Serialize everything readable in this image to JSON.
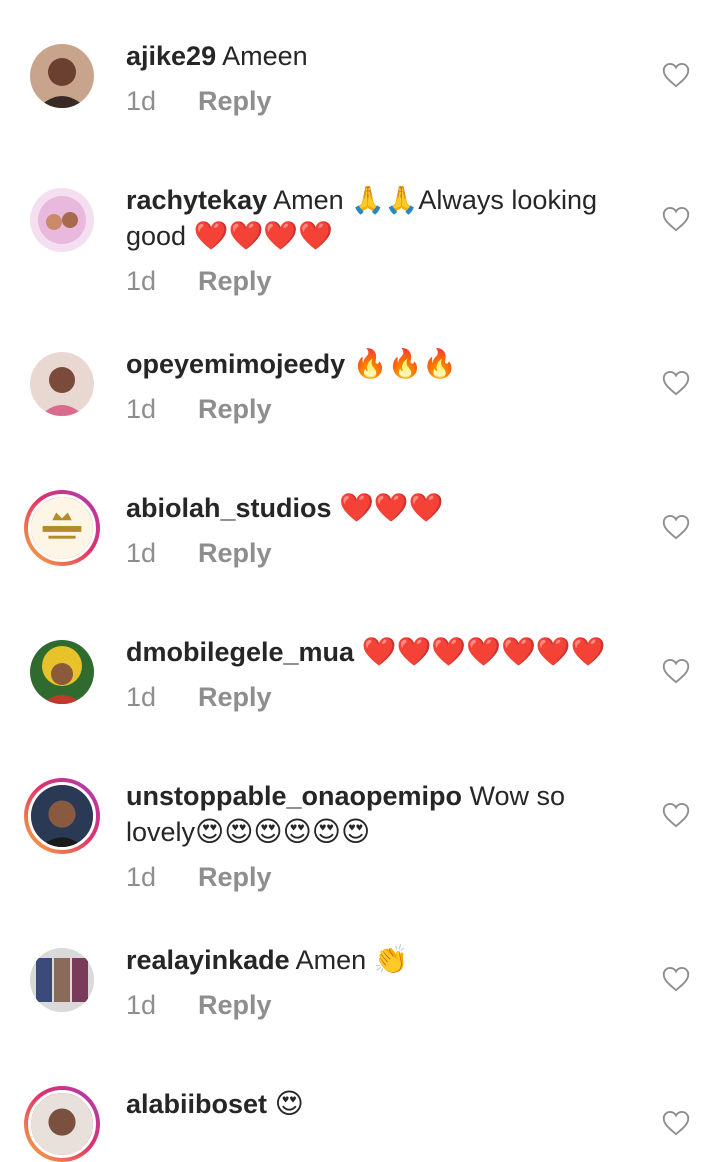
{
  "comments": [
    {
      "username": "ajike29",
      "text": " Ameen",
      "emojis": "",
      "time": "1d",
      "reply": "Reply"
    },
    {
      "username": "rachytekay",
      "text": " Amen 🙏🙏Always looking good ",
      "emojis": "❤️❤️❤️❤️",
      "time": "1d",
      "reply": "Reply"
    },
    {
      "username": "opeyemimojeedy",
      "text": " ",
      "emojis": "🔥🔥🔥",
      "time": "1d",
      "reply": "Reply"
    },
    {
      "username": "abiolah_studios",
      "text": " ",
      "emojis": "❤️❤️❤️",
      "time": "1d",
      "reply": "Reply"
    },
    {
      "username": "dmobilegele_mua",
      "text": " ",
      "emojis": "❤️❤️❤️❤️❤️❤️❤️",
      "time": "1d",
      "reply": "Reply"
    },
    {
      "username": "unstoppable_onaopemipo",
      "text": " Wow so lovely",
      "emojis": "😍😍😍😍😍😍",
      "time": "1d",
      "reply": "Reply"
    },
    {
      "username": "realayinkade",
      "text": " Amen ",
      "emojis": "👏",
      "time": "1d",
      "reply": "Reply"
    },
    {
      "username": "alabiiboset",
      "text": " ",
      "emojis": "😍",
      "time": "",
      "reply": ""
    }
  ]
}
